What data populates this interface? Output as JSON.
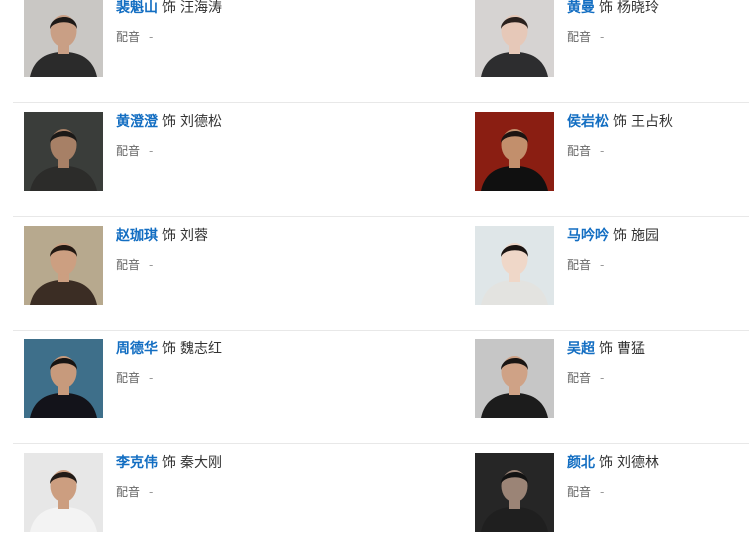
{
  "separator": "饰",
  "dub_label": "配音",
  "dub_empty": "-",
  "cast": [
    {
      "actor": "裴魁山",
      "role": "汪海涛",
      "photo": {
        "bg": "#c9c7c4",
        "skin": "#c99f85",
        "hair": "#1e1a18",
        "shirt": "#2b2b2b"
      }
    },
    {
      "actor": "黄曼",
      "role": "杨晓玲",
      "photo": {
        "bg": "#d6d3d2",
        "skin": "#e6c8b8",
        "hair": "#2a211e",
        "shirt": "#2d2d2f"
      }
    },
    {
      "actor": "黄澄澄",
      "role": "刘德松",
      "photo": {
        "bg": "#3a3d3a",
        "skin": "#a78066",
        "hair": "#1b1917",
        "shirt": "#2c2c2a"
      }
    },
    {
      "actor": "侯岩松",
      "role": "王占秋",
      "photo": {
        "bg": "#8a1e12",
        "skin": "#c28f6c",
        "hair": "#1c1411",
        "shirt": "#101010"
      }
    },
    {
      "actor": "赵珈琪",
      "role": "刘蓉",
      "photo": {
        "bg": "#b7a98e",
        "skin": "#cc9f81",
        "hair": "#231913",
        "shirt": "#3b2d24"
      }
    },
    {
      "actor": "马吟吟",
      "role": "施园",
      "photo": {
        "bg": "#dfe6e8",
        "skin": "#efd7c8",
        "hair": "#1a1412",
        "shirt": "#e3e3e0"
      }
    },
    {
      "actor": "周德华",
      "role": "魏志红",
      "photo": {
        "bg": "#3e6f8a",
        "skin": "#c79a7c",
        "hair": "#171412",
        "shirt": "#13131a"
      }
    },
    {
      "actor": "吴超",
      "role": "曹猛",
      "photo": {
        "bg": "#c6c6c6",
        "skin": "#cfa286",
        "hair": "#191513",
        "shirt": "#1c1c1c"
      }
    },
    {
      "actor": "李克伟",
      "role": "秦大刚",
      "photo": {
        "bg": "#e7e7e7",
        "skin": "#cc9e80",
        "hair": "#221b17",
        "shirt": "#f3f3f3"
      }
    },
    {
      "actor": "颜北",
      "role": "刘德林",
      "photo": {
        "bg": "#262626",
        "skin": "#9b8476",
        "hair": "#121212",
        "shirt": "#1f1f1f"
      }
    }
  ]
}
